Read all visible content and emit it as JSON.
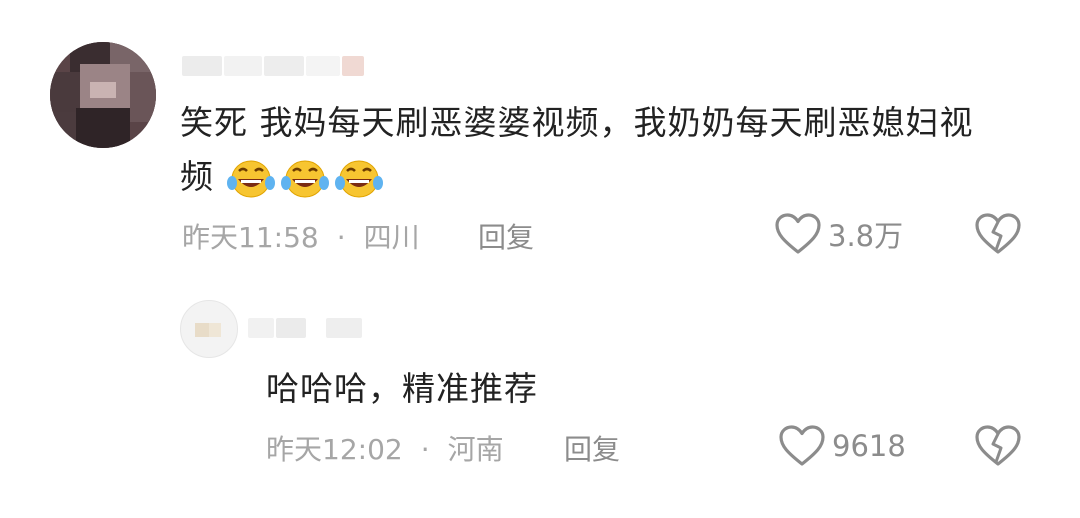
{
  "comments": [
    {
      "text": "笑死 我妈每天刷恶婆婆视频，我奶奶每天刷恶媳妇视",
      "text_line2": "频",
      "emojis": [
        "laughing-crying-emoji",
        "laughing-crying-emoji",
        "laughing-crying-emoji"
      ],
      "time": "昨天11:58",
      "separator": "·",
      "location": "四川",
      "reply_label": "回复",
      "likes": "3.8万"
    },
    {
      "text": "哈哈哈，精准推荐",
      "time": "昨天12:02",
      "separator": "·",
      "location": "河南",
      "reply_label": "回复",
      "likes": "9618"
    }
  ],
  "icons": {
    "like": "heart-outline-icon",
    "dislike": "broken-heart-icon"
  },
  "colors": {
    "text": "#222222",
    "meta": "#a6a6a6",
    "icon": "#8c8c8c"
  }
}
